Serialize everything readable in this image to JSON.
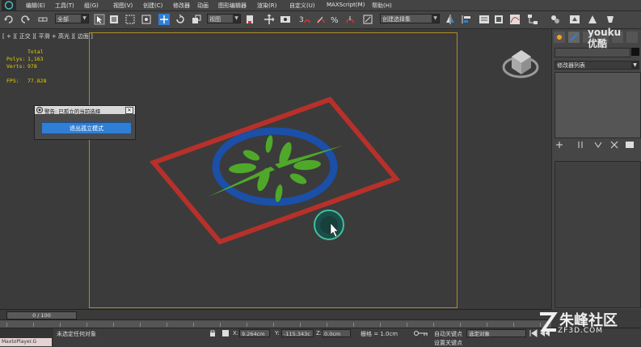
{
  "menu": [
    "编辑(E)",
    "工具(T)",
    "组(G)",
    "视图(V)",
    "创建(C)",
    "修改器",
    "动画",
    "图形编辑器",
    "渲染(R)",
    "自定义(U)",
    "MAXScript(M)",
    "帮助(H)"
  ],
  "toolbar": {
    "selection_filter": "全部",
    "ref_coord": "视图",
    "named_selection": "创建选择集"
  },
  "viewport": {
    "label": "[ + ][ 正交 ][ 平滑 + 高光 ][ 边面 ]",
    "stats": {
      "total_label": "Total",
      "polys_label": "Polys:",
      "polys_value": "1,163",
      "verts_label": "Verts:",
      "verts_value": "978",
      "fps_label": "FPS:",
      "fps_value": "77.828"
    }
  },
  "dialog": {
    "title": "警告: 已孤立的当前选择",
    "button": "退出孤立模式"
  },
  "right_panel": {
    "modifier_list": "修改器列表"
  },
  "timeline": {
    "slider": "0 / 100"
  },
  "status": {
    "max_player": "MaxtoPlayer.G",
    "selection_text": "未选定任何对象",
    "x_label": "X:",
    "x_value": "9.264cm",
    "y_label": "Y:",
    "y_value": "-115.343c",
    "z_label": "Z:",
    "z_value": "0.0cm",
    "grid": "栅格 = 1.0cm",
    "auto_key": "自动关键点",
    "selected_object": "选定对象",
    "set_key": "设置关键点"
  },
  "watermarks": {
    "youku": "youku",
    "youku_cn": "优酷",
    "site_cn": "朱峰社区",
    "site_url": "ZF3D.COM"
  },
  "colors": {
    "accent_blue": "#2f7fd6",
    "frame_red": "#b8302a",
    "ring_blue": "#1b4fa8",
    "leaf_green": "#4fa82a",
    "stats_yellow": "#e8d000",
    "viewport_border": "#b28a25"
  }
}
